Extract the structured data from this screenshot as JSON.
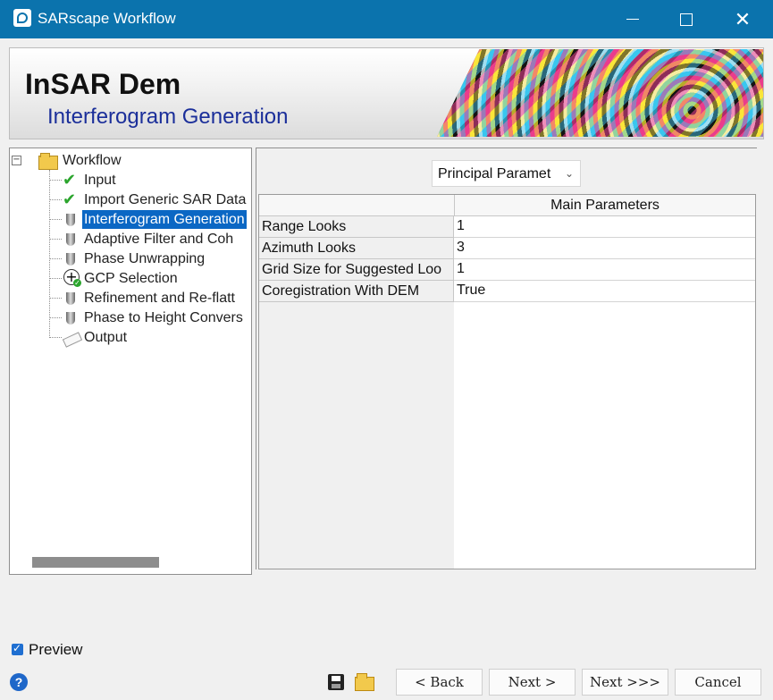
{
  "window": {
    "title": "SARscape Workflow"
  },
  "banner": {
    "title": "InSAR Dem",
    "subtitle": "Interferogram Generation"
  },
  "tree": {
    "root": "Workflow",
    "items": [
      {
        "label": "Input",
        "icon": "check-icon"
      },
      {
        "label": "Import Generic SAR Data",
        "icon": "check-icon"
      },
      {
        "label": "Interferogram Generation",
        "icon": "drill-icon",
        "selected": true
      },
      {
        "label": "Adaptive Filter and Coh",
        "icon": "drill-icon"
      },
      {
        "label": "Phase Unwrapping",
        "icon": "drill-icon"
      },
      {
        "label": "GCP Selection",
        "icon": "plus-icon"
      },
      {
        "label": "Refinement and Re-flatt",
        "icon": "drill-icon"
      },
      {
        "label": "Phase to Height Convers",
        "icon": "drill-icon"
      },
      {
        "label": "Output",
        "icon": "output-icon"
      }
    ]
  },
  "params": {
    "dropdown_value": "Principal Paramet",
    "header": "Main Parameters",
    "rows": [
      {
        "name": "Range Looks",
        "value": "1"
      },
      {
        "name": "Azimuth Looks",
        "value": "3"
      },
      {
        "name": "Grid Size for Suggested Loo",
        "value": "1"
      },
      {
        "name": "Coregistration With DEM",
        "value": "True"
      }
    ]
  },
  "footer": {
    "preview_label": "Preview",
    "help": "?",
    "back": "< Back",
    "next": "Next >",
    "next_all": "Next >>>",
    "cancel": "Cancel"
  }
}
